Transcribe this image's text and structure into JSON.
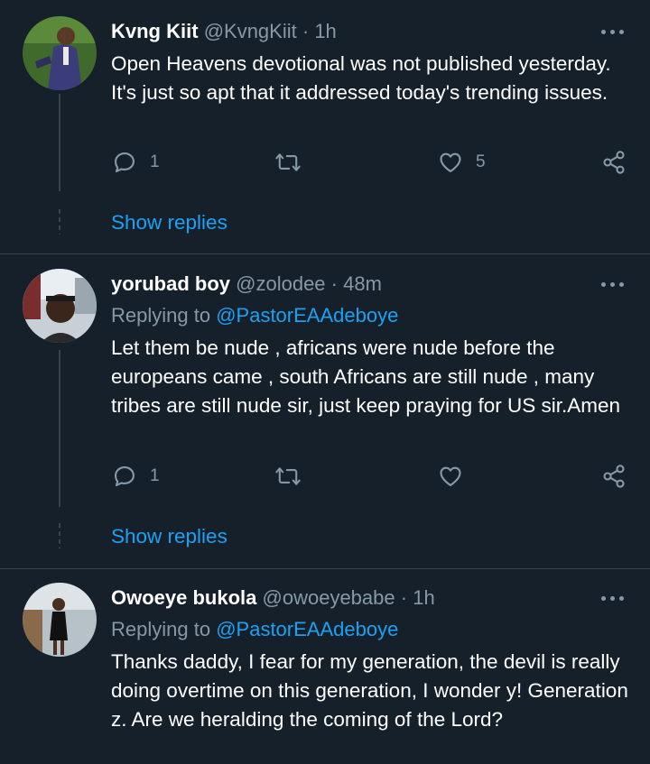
{
  "tweets": [
    {
      "name": "Kvng Kiit",
      "handle": "@KvngKiit",
      "separator": "·",
      "time": "1h",
      "reply_prefix": "",
      "reply_mention": "",
      "text": "Open Heavens devotional was not published yesterday. It's just so apt that it addressed today's trending issues.",
      "replies": "1",
      "retweets": "",
      "likes": "5",
      "show_replies": "Show replies"
    },
    {
      "name": "yorubad boy",
      "handle": "@zolodee",
      "separator": "·",
      "time": "48m",
      "reply_prefix": "Replying to",
      "reply_mention": "@PastorEAAdeboye",
      "text": "Let them be nude , africans were nude before the europeans came , south Africans are still nude , many tribes are still nude sir, just keep praying for US sir.Amen",
      "replies": "1",
      "retweets": "",
      "likes": "",
      "show_replies": "Show replies"
    },
    {
      "name": "Owoeye bukola",
      "handle": "@owoeyebabe",
      "separator": "·",
      "time": "1h",
      "reply_prefix": "Replying to",
      "reply_mention": "@PastorEAAdeboye",
      "text": "Thanks daddy, I fear for my generation,  the devil is really doing overtime on this generation,  I wonder y! Generation z. Are we heralding the coming of the Lord?"
    }
  ],
  "icons": {
    "reply": "reply-icon",
    "retweet": "retweet-icon",
    "like": "heart-icon",
    "share": "share-icon",
    "more": "more-icon"
  },
  "colors": {
    "background": "#15202b",
    "secondary_text": "#8899a6",
    "accent": "#1da1f2",
    "divider": "#38444d"
  }
}
